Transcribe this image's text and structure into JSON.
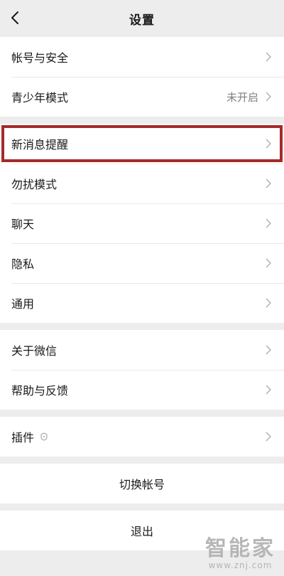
{
  "header": {
    "title": "设置"
  },
  "groups": [
    {
      "items": [
        {
          "label": "帐号与安全",
          "value": ""
        },
        {
          "label": "青少年模式",
          "value": "未开启"
        }
      ]
    },
    {
      "items": [
        {
          "label": "新消息提醒",
          "value": ""
        },
        {
          "label": "勿扰模式",
          "value": ""
        },
        {
          "label": "聊天",
          "value": ""
        },
        {
          "label": "隐私",
          "value": ""
        },
        {
          "label": "通用",
          "value": ""
        }
      ]
    },
    {
      "items": [
        {
          "label": "关于微信",
          "value": ""
        },
        {
          "label": "帮助与反馈",
          "value": ""
        }
      ]
    },
    {
      "items": [
        {
          "label": "插件",
          "value": ""
        }
      ]
    }
  ],
  "actions": {
    "switch_account": "切换帐号",
    "logout": "退出"
  },
  "watermark": {
    "brand": "智能家",
    "url": "www.znj.com"
  },
  "colors": {
    "highlight_border": "#a52a2a",
    "background": "#ededed"
  }
}
